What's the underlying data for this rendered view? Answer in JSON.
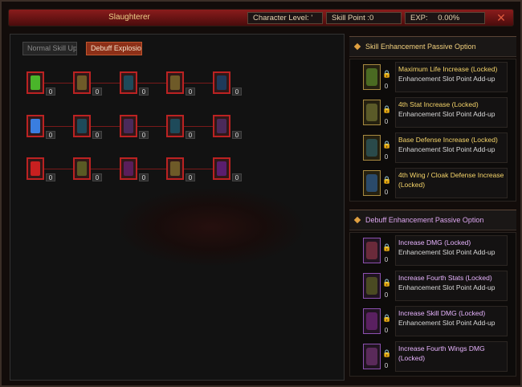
{
  "window": {
    "title": "Slaughterer",
    "character_level_label": "Character Level: '",
    "skill_point_label": "Skill Point :0",
    "exp_label": "EXP:",
    "exp_value": "0.00%",
    "close_symbol": "✕"
  },
  "tabs": [
    {
      "label": "Normal Skill Upgr",
      "active": false
    },
    {
      "label": "Debuff Explosion",
      "active": true
    }
  ],
  "skill_tree": {
    "rows": [
      [
        "0",
        "0",
        "0",
        "0",
        "0"
      ],
      [
        "0",
        "0",
        "0",
        "0",
        "0"
      ],
      [
        "0",
        "0",
        "0",
        "0",
        "0"
      ]
    ]
  },
  "right_panel": {
    "skill_section": {
      "title": "Skill Enhancement Passive Option",
      "options": [
        {
          "title": "Maximum Life Increase (Locked)",
          "subtitle": "Enhancement Slot Point Add-up",
          "count": "0",
          "icon": "scroll-green-icon"
        },
        {
          "title": "4th Stat Increase (Locked)",
          "subtitle": "Enhancement Slot Point Add-up",
          "count": "0",
          "icon": "scroll-olive-icon"
        },
        {
          "title": "Base Defense Increase (Locked)",
          "subtitle": "Enhancement Slot Point Add-up",
          "count": "0",
          "icon": "scroll-teal-icon"
        },
        {
          "title": "4th Wing / Cloak Defense Increase (Locked)",
          "subtitle": "",
          "count": "0",
          "icon": "scroll-blue-icon"
        }
      ]
    },
    "debuff_section": {
      "title": "Debuff Enhancement Passive Option",
      "options": [
        {
          "title": "Increase DMG (Locked)",
          "subtitle": "Enhancement Slot Point Add-up",
          "count": "0",
          "icon": "claw-red-icon"
        },
        {
          "title": "Increase Fourth Stats (Locked)",
          "subtitle": "Enhancement Slot Point Add-up",
          "count": "0",
          "icon": "claw-olive-icon"
        },
        {
          "title": "Increase Skill DMG (Locked)",
          "subtitle": "Enhancement Slot Point Add-up",
          "count": "0",
          "icon": "claw-purple-icon"
        },
        {
          "title": "Increase Fourth Wings DMG (Locked)",
          "subtitle": "",
          "count": "0",
          "icon": "claw-violet-icon"
        }
      ]
    }
  },
  "colors": {
    "accent_gold": "#f6d56a",
    "accent_pink": "#e8b4ff",
    "node_border": "#bb2222"
  }
}
